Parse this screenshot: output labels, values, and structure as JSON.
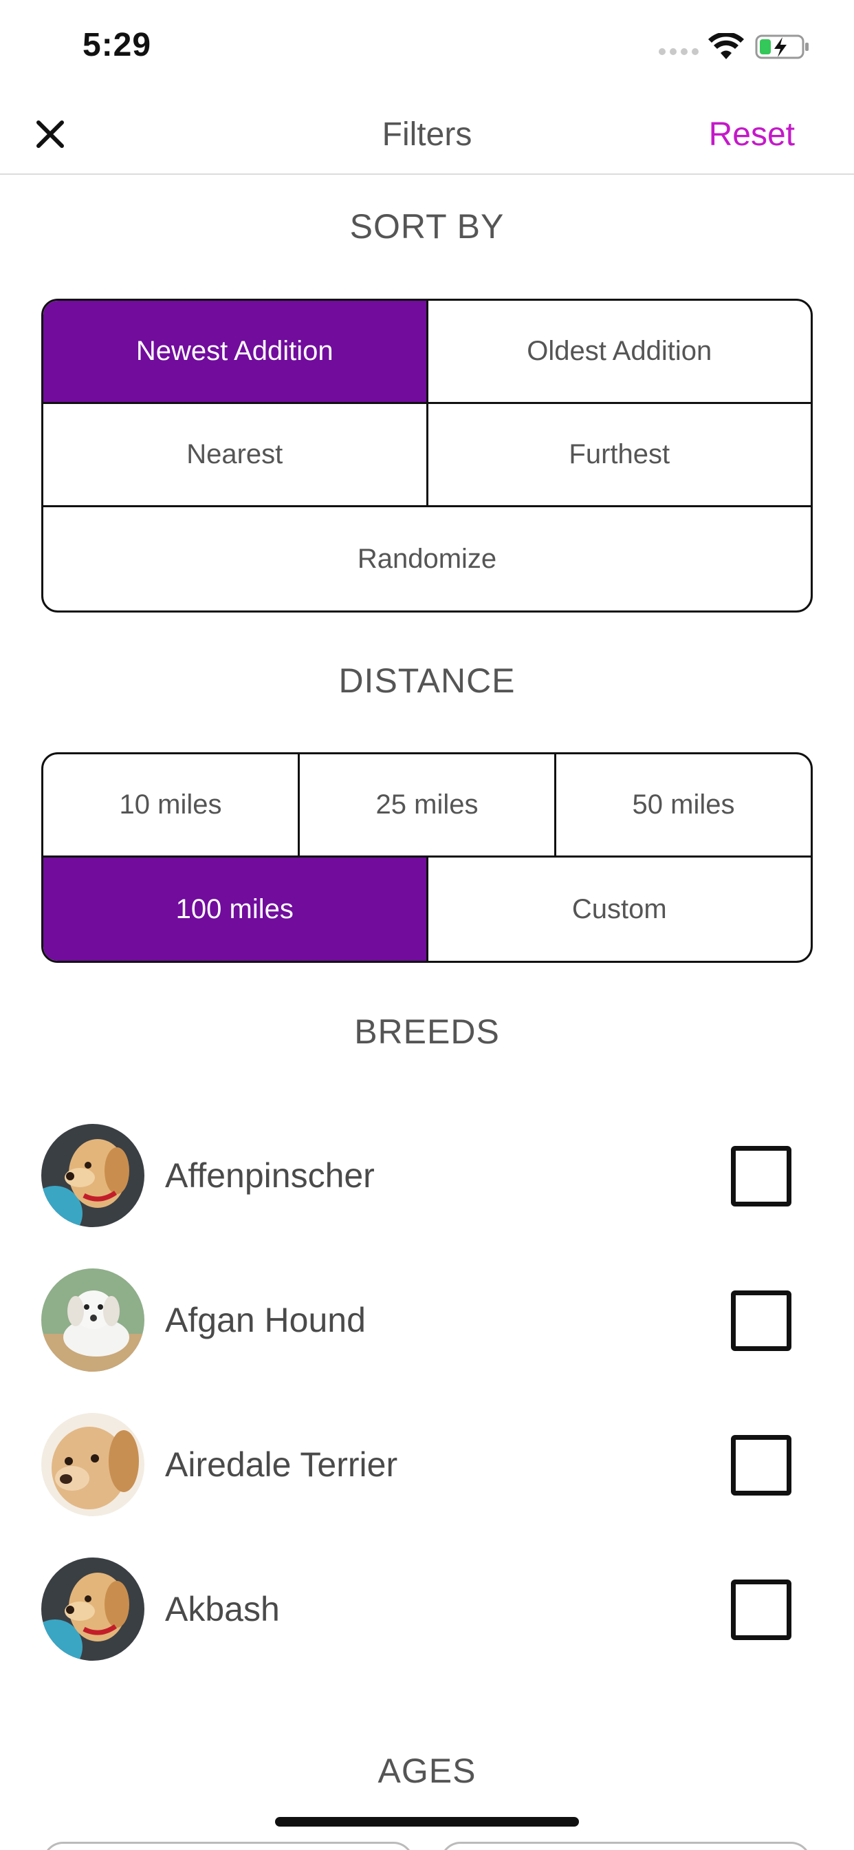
{
  "status_bar": {
    "time": "5:29"
  },
  "nav": {
    "title": "Filters",
    "reset_label": "Reset"
  },
  "sort_by": {
    "title": "SORT BY",
    "options": [
      "Newest Addition",
      "Oldest Addition",
      "Nearest",
      "Furthest",
      "Randomize"
    ],
    "selected": "Newest Addition"
  },
  "distance": {
    "title": "DISTANCE",
    "options": [
      "10 miles",
      "25 miles",
      "50 miles",
      "100 miles",
      "Custom"
    ],
    "selected": "100 miles"
  },
  "breeds": {
    "title": "BREEDS",
    "items": [
      {
        "name": "Affenpinscher",
        "checked": false
      },
      {
        "name": "Afgan Hound",
        "checked": false
      },
      {
        "name": "Airedale Terrier",
        "checked": false
      },
      {
        "name": "Akbash",
        "checked": false
      }
    ]
  },
  "ages": {
    "title": "AGES"
  },
  "colors": {
    "accent": "#710c9d",
    "reset": "#c419c9"
  }
}
